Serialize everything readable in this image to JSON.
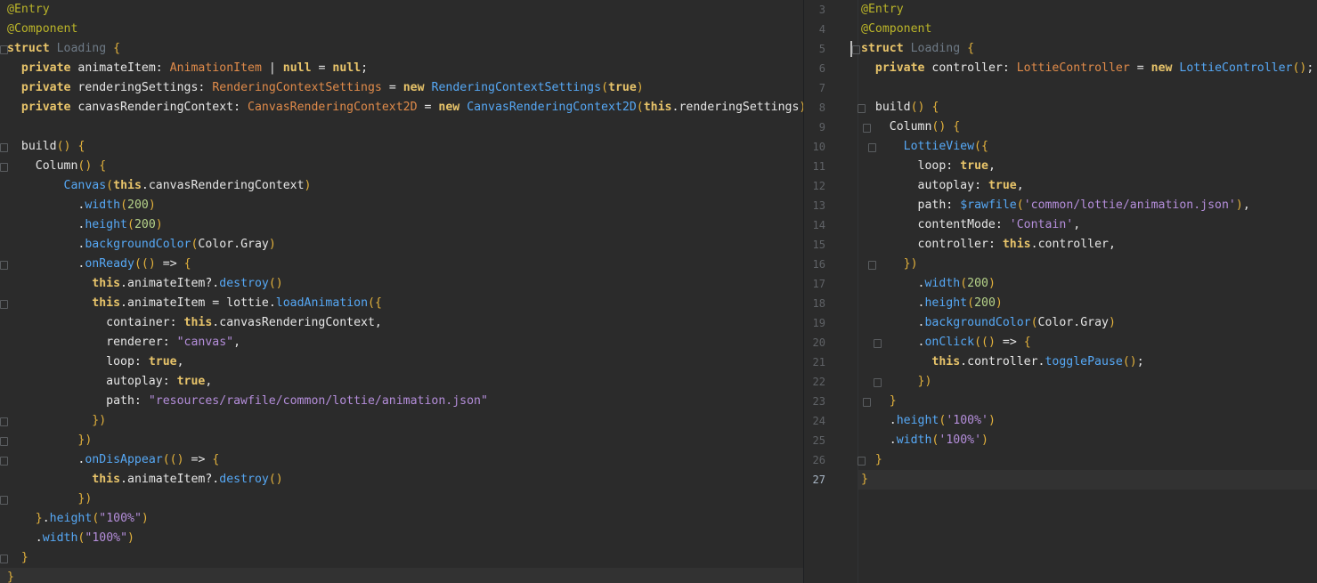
{
  "left_editor": {
    "lines": [
      "@Entry",
      "@Component",
      "struct Loading {",
      "  private animateItem: AnimationItem | null = null;",
      "  private renderingSettings: RenderingContextSettings = new RenderingContextSettings(true)",
      "  private canvasRenderingContext: CanvasRenderingContext2D = new CanvasRenderingContext2D(this.renderingSettings)",
      "",
      "  build() {",
      "    Column() {",
      "        Canvas(this.canvasRenderingContext)",
      "          .width(200)",
      "          .height(200)",
      "          .backgroundColor(Color.Gray)",
      "          .onReady(() => {",
      "            this.animateItem?.destroy()",
      "            this.animateItem = lottie.loadAnimation({",
      "              container: this.canvasRenderingContext,",
      "              renderer: \"canvas\",",
      "              loop: true,",
      "              autoplay: true,",
      "              path: \"resources/rawfile/common/lottie/animation.json\"",
      "            })",
      "          })",
      "          .onDisAppear(() => {",
      "            this.animateItem?.destroy()",
      "          })",
      "    }.height(\"100%\")",
      "    .width(\"100%\")",
      "  }",
      "}"
    ]
  },
  "right_editor": {
    "line_numbers": [
      "3",
      "4",
      "5",
      "6",
      "7",
      "8",
      "9",
      "10",
      "11",
      "12",
      "13",
      "14",
      "15",
      "16",
      "17",
      "18",
      "19",
      "20",
      "21",
      "22",
      "23",
      "24",
      "25",
      "26",
      "27"
    ],
    "active_line": "27",
    "lines": [
      "@Entry",
      "@Component",
      "struct Loading {",
      "  private controller: LottieController = new LottieController();",
      "",
      "  build() {",
      "    Column() {",
      "      LottieView({",
      "        loop: true,",
      "        autoplay: true,",
      "        path: $rawfile('common/lottie/animation.json'),",
      "        contentMode: 'Contain',",
      "        controller: this.controller,",
      "      })",
      "        .width(200)",
      "        .height(200)",
      "        .backgroundColor(Color.Gray)",
      "        .onClick(() => {",
      "          this.controller.togglePause();",
      "        })",
      "    }",
      "    .height('100%')",
      "    .width('100%')",
      "  }",
      "}"
    ]
  },
  "colors": {
    "background": "#2b2b2b",
    "annotation": "#bbb529",
    "keyword": "#e8c46a",
    "type": "#e08b4a",
    "function": "#56a8f5",
    "string": "#b58edb",
    "number": "#b6d38a"
  }
}
